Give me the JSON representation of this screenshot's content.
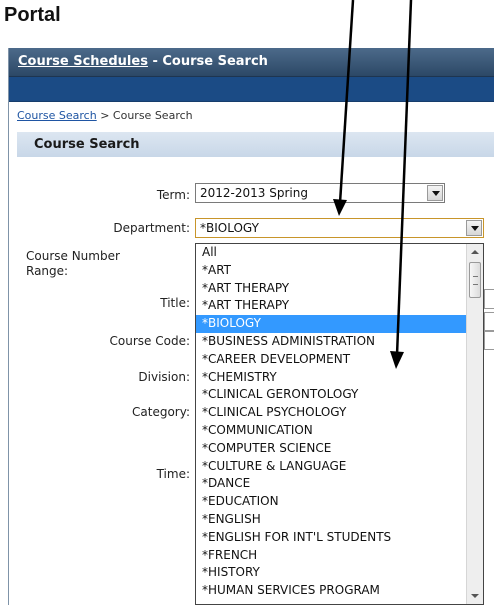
{
  "page": {
    "title": "Portal"
  },
  "header": {
    "link": "Course Schedules",
    "separator": " - ",
    "title": "Course Search"
  },
  "breadcrumb": {
    "link": "Course Search",
    "separator": " > ",
    "current": "Course Search"
  },
  "section": {
    "title": "Course Search"
  },
  "form": {
    "term_label": "Term:",
    "term_value": "2012-2013 Spring",
    "department_label": "Department:",
    "department_value": "*BIOLOGY",
    "course_number_label_1": "Course Number",
    "course_number_label_2": "Range:",
    "title_label": "Title:",
    "course_code_label": "Course Code:",
    "division_label": "Division:",
    "category_label": "Category:",
    "time_label": "Time:"
  },
  "dropdown": {
    "selected_index": 4,
    "options": [
      "All",
      "*ART",
      "*ART THERAPY",
      "*ART THERAPY",
      "*BIOLOGY",
      "*BUSINESS ADMINISTRATION",
      "*CAREER DEVELOPMENT",
      "*CHEMISTRY",
      "*CLINICAL GERONTOLOGY",
      "*CLINICAL PSYCHOLOGY",
      "*COMMUNICATION",
      "*COMPUTER SCIENCE",
      "*CULTURE & LANGUAGE",
      "*DANCE",
      "*EDUCATION",
      "*ENGLISH",
      "*ENGLISH FOR INT'L STUDENTS",
      "*FRENCH",
      "*HISTORY",
      "*HUMAN SERVICES PROGRAM"
    ]
  },
  "colors": {
    "header": "#2c4866",
    "blue_bar": "#1b4b85",
    "highlight": "#3399ff",
    "link": "#1f55a3"
  }
}
